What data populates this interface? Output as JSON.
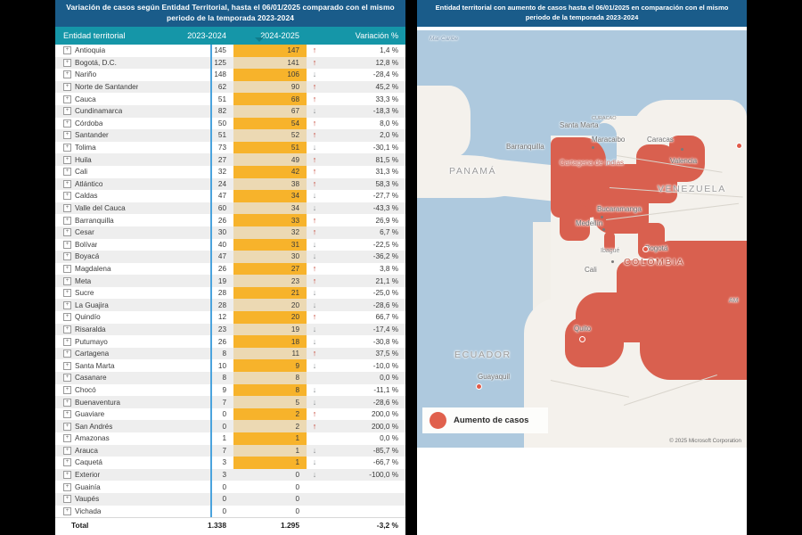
{
  "table_panel": {
    "title": "Variación de casos según Entidad Territorial, hasta el 06/01/2025 comparado con el mismo periodo de la temporada 2023-2024",
    "columns": {
      "entity": "Entidad territorial",
      "prev": "2023-2024",
      "curr": "2024-2025",
      "variation": "Variación %"
    },
    "sort_indicator": "descending-on-2024-2025",
    "expand_glyph": "+",
    "highlight_color": "#f7b32b",
    "up_arrow_color": "#c03b2b",
    "down_arrow_color": "#8e9295",
    "rows": [
      {
        "entity": "Antioquia",
        "prev": "145",
        "curr": "147",
        "trend": "up",
        "variation": "1,4 %"
      },
      {
        "entity": "Bogotá, D.C.",
        "prev": "125",
        "curr": "141",
        "trend": "up",
        "variation": "12,8 %"
      },
      {
        "entity": "Nariño",
        "prev": "148",
        "curr": "106",
        "trend": "down",
        "variation": "-28,4 %"
      },
      {
        "entity": "Norte de Santander",
        "prev": "62",
        "curr": "90",
        "trend": "up",
        "variation": "45,2 %"
      },
      {
        "entity": "Cauca",
        "prev": "51",
        "curr": "68",
        "trend": "up",
        "variation": "33,3 %"
      },
      {
        "entity": "Cundinamarca",
        "prev": "82",
        "curr": "67",
        "trend": "down",
        "variation": "-18,3 %"
      },
      {
        "entity": "Córdoba",
        "prev": "50",
        "curr": "54",
        "trend": "up",
        "variation": "8,0 %"
      },
      {
        "entity": "Santander",
        "prev": "51",
        "curr": "52",
        "trend": "up",
        "variation": "2,0 %"
      },
      {
        "entity": "Tolima",
        "prev": "73",
        "curr": "51",
        "trend": "down",
        "variation": "-30,1 %"
      },
      {
        "entity": "Huila",
        "prev": "27",
        "curr": "49",
        "trend": "up",
        "variation": "81,5 %"
      },
      {
        "entity": "Cali",
        "prev": "32",
        "curr": "42",
        "trend": "up",
        "variation": "31,3 %"
      },
      {
        "entity": "Atlántico",
        "prev": "24",
        "curr": "38",
        "trend": "up",
        "variation": "58,3 %"
      },
      {
        "entity": "Caldas",
        "prev": "47",
        "curr": "34",
        "trend": "down",
        "variation": "-27,7 %"
      },
      {
        "entity": "Valle del Cauca",
        "prev": "60",
        "curr": "34",
        "trend": "down",
        "variation": "-43,3 %"
      },
      {
        "entity": "Barranquilla",
        "prev": "26",
        "curr": "33",
        "trend": "up",
        "variation": "26,9 %"
      },
      {
        "entity": "Cesar",
        "prev": "30",
        "curr": "32",
        "trend": "up",
        "variation": "6,7 %"
      },
      {
        "entity": "Bolívar",
        "prev": "40",
        "curr": "31",
        "trend": "down",
        "variation": "-22,5 %"
      },
      {
        "entity": "Boyacá",
        "prev": "47",
        "curr": "30",
        "trend": "down",
        "variation": "-36,2 %"
      },
      {
        "entity": "Magdalena",
        "prev": "26",
        "curr": "27",
        "trend": "up",
        "variation": "3,8 %"
      },
      {
        "entity": "Meta",
        "prev": "19",
        "curr": "23",
        "trend": "up",
        "variation": "21,1 %"
      },
      {
        "entity": "Sucre",
        "prev": "28",
        "curr": "21",
        "trend": "down",
        "variation": "-25,0 %"
      },
      {
        "entity": "La Guajira",
        "prev": "28",
        "curr": "20",
        "trend": "down",
        "variation": "-28,6 %"
      },
      {
        "entity": "Quindío",
        "prev": "12",
        "curr": "20",
        "trend": "up",
        "variation": "66,7 %"
      },
      {
        "entity": "Risaralda",
        "prev": "23",
        "curr": "19",
        "trend": "down",
        "variation": "-17,4 %"
      },
      {
        "entity": "Putumayo",
        "prev": "26",
        "curr": "18",
        "trend": "down",
        "variation": "-30,8 %"
      },
      {
        "entity": "Cartagena",
        "prev": "8",
        "curr": "11",
        "trend": "up",
        "variation": "37,5 %"
      },
      {
        "entity": "Santa Marta",
        "prev": "10",
        "curr": "9",
        "trend": "down",
        "variation": "-10,0 %"
      },
      {
        "entity": "Casanare",
        "prev": "8",
        "curr": "8",
        "trend": "none",
        "variation": "0,0 %"
      },
      {
        "entity": "Chocó",
        "prev": "9",
        "curr": "8",
        "trend": "down",
        "variation": "-11,1 %"
      },
      {
        "entity": "Buenaventura",
        "prev": "7",
        "curr": "5",
        "trend": "down",
        "variation": "-28,6 %"
      },
      {
        "entity": "Guaviare",
        "prev": "0",
        "curr": "2",
        "trend": "up",
        "variation": "200,0 %"
      },
      {
        "entity": "San Andrés",
        "prev": "0",
        "curr": "2",
        "trend": "up",
        "variation": "200,0 %"
      },
      {
        "entity": "Amazonas",
        "prev": "1",
        "curr": "1",
        "trend": "none",
        "variation": "0,0 %"
      },
      {
        "entity": "Arauca",
        "prev": "7",
        "curr": "1",
        "trend": "down",
        "variation": "-85,7 %"
      },
      {
        "entity": "Caquetá",
        "prev": "3",
        "curr": "1",
        "trend": "down",
        "variation": "-66,7 %"
      },
      {
        "entity": "Exterior",
        "prev": "3",
        "curr": "0",
        "trend": "down",
        "variation": "-100,0 %"
      },
      {
        "entity": "Guainía",
        "prev": "0",
        "curr": "0",
        "trend": "none",
        "variation": ""
      },
      {
        "entity": "Vaupés",
        "prev": "0",
        "curr": "0",
        "trend": "none",
        "variation": ""
      },
      {
        "entity": "Vichada",
        "prev": "0",
        "curr": "0",
        "trend": "none",
        "variation": ""
      }
    ],
    "total": {
      "entity": "Total",
      "prev": "1.338",
      "curr": "1.295",
      "variation": "-3,2 %"
    }
  },
  "map_panel": {
    "title": "Entidad territorial con aumento de casos hasta el 06/01/2025 en comparación con el mismo periodo de la temporada 2023-2024",
    "legend": {
      "label": "Aumento de casos",
      "color": "#e0604c"
    },
    "copyright": "© 2025 Microsoft Corporation",
    "labels": {
      "water": "Mar Caribe",
      "countries": [
        "PANAMÁ",
        "VENEZUELA",
        "COLOMBIA",
        "ECUADOR"
      ],
      "cities": [
        "Santa Marta",
        "Barranquilla",
        "Cartagena de Indias",
        "Maracaibo",
        "Caracas",
        "Valencia",
        "Bucaramanga",
        "Medellín",
        "Bogotá",
        "Ibagué",
        "Cali",
        "Quito",
        "Guayaquil"
      ],
      "partial": [
        "AM",
        "CURACAO"
      ]
    }
  }
}
